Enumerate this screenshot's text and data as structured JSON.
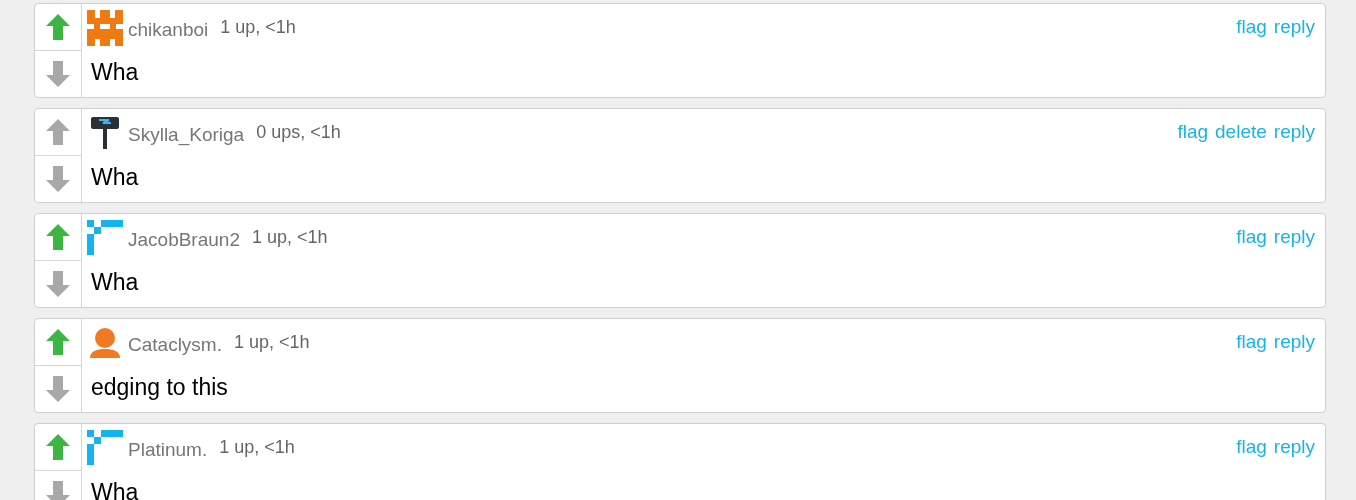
{
  "comments": [
    {
      "avatar": {
        "kind": "castle"
      },
      "username": "chikanboi",
      "meta": "1 up, <1h",
      "upvoted": true,
      "actions": [
        "flag",
        "reply"
      ],
      "text": "Wha"
    },
    {
      "avatar": {
        "kind": "hammer"
      },
      "username": "Skylla_Koriga",
      "meta": "0 ups, <1h",
      "upvoted": false,
      "actions": [
        "flag",
        "delete",
        "reply"
      ],
      "text": "Wha"
    },
    {
      "avatar": {
        "kind": "pixel"
      },
      "username": "JacobBraun2",
      "meta": "1 up, <1h",
      "upvoted": true,
      "actions": [
        "flag",
        "reply"
      ],
      "text": "Wha"
    },
    {
      "avatar": {
        "kind": "person"
      },
      "username": "Cataclysm.",
      "meta": "1 up, <1h",
      "upvoted": true,
      "actions": [
        "flag",
        "reply"
      ],
      "text": "edging to this"
    },
    {
      "avatar": {
        "kind": "pixel"
      },
      "username": "Platinum.",
      "meta": "1 up, <1h",
      "upvoted": true,
      "actions": [
        "flag",
        "reply"
      ],
      "text": "Wha"
    }
  ]
}
